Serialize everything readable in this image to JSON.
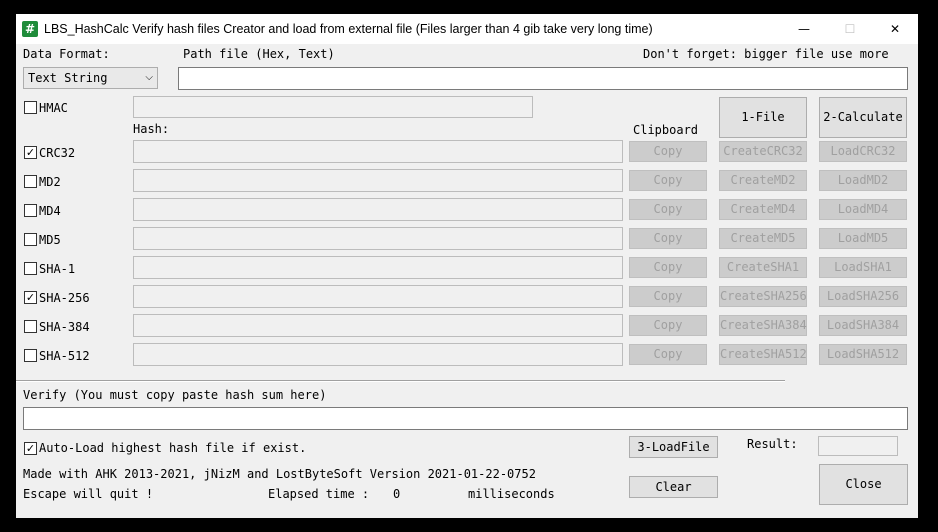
{
  "window": {
    "title": "LBS_HashCalc Verify hash files Creator and load from external file (Files larger than 4 gib take very long time)",
    "icon_glyph": "#",
    "minimize": "—",
    "maximize": "☐",
    "close": "✕"
  },
  "header": {
    "data_format_label": "Data Format:",
    "path_label": "Path file (Hex, Text)",
    "note": "Don't forget: bigger file use more",
    "data_format_value": "Text String",
    "path_value": ""
  },
  "hmac": {
    "label": "HMAC",
    "checked": false,
    "value": ""
  },
  "columns": {
    "hash": "Hash:",
    "clipboard": "Clipboard"
  },
  "actions": {
    "file": "1-File",
    "calculate": "2-Calculate"
  },
  "hashes": [
    {
      "label": "CRC32",
      "checked": true,
      "copy": "Copy",
      "create": "CreateCRC32",
      "load": "LoadCRC32",
      "value": ""
    },
    {
      "label": "MD2",
      "checked": false,
      "copy": "Copy",
      "create": "CreateMD2",
      "load": "LoadMD2",
      "value": ""
    },
    {
      "label": "MD4",
      "checked": false,
      "copy": "Copy",
      "create": "CreateMD4",
      "load": "LoadMD4",
      "value": ""
    },
    {
      "label": "MD5",
      "checked": false,
      "copy": "Copy",
      "create": "CreateMD5",
      "load": "LoadMD5",
      "value": ""
    },
    {
      "label": "SHA-1",
      "checked": false,
      "copy": "Copy",
      "create": "CreateSHA1",
      "load": "LoadSHA1",
      "value": ""
    },
    {
      "label": "SHA-256",
      "checked": true,
      "copy": "Copy",
      "create": "CreateSHA256",
      "load": "LoadSHA256",
      "value": ""
    },
    {
      "label": "SHA-384",
      "checked": false,
      "copy": "Copy",
      "create": "CreateSHA384",
      "load": "LoadSHA384",
      "value": ""
    },
    {
      "label": "SHA-512",
      "checked": false,
      "copy": "Copy",
      "create": "CreateSHA512",
      "load": "LoadSHA512",
      "value": ""
    }
  ],
  "verify": {
    "label": "Verify (You must copy paste hash sum here)",
    "value": ""
  },
  "autoload": {
    "label": "Auto-Load highest hash file if exist.",
    "checked": true
  },
  "load_file_button": "3-LoadFile",
  "result": {
    "label": "Result:",
    "value": ""
  },
  "footer": {
    "credits": "Made with AHK 2013-2021, jNizM and LostByteSoft Version 2021-01-22-0752",
    "escape": "Escape will quit !",
    "elapsed_label": "Elapsed time :",
    "elapsed_value": "0",
    "elapsed_unit": "milliseconds",
    "clear": "Clear",
    "close": "Close"
  }
}
